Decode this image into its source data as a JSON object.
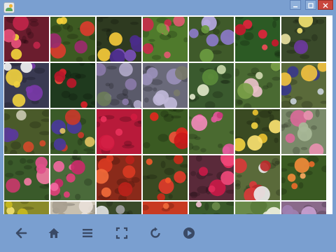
{
  "window": {
    "icon": "photo-viewer-app-icon",
    "controls": [
      "minimize-icon",
      "maximize-icon",
      "close-icon"
    ]
  },
  "grid": {
    "tiles": [
      {
        "bg": "#6b1d2e",
        "accents": [
          "#c0254a",
          "#f2d23c",
          "#e6507a"
        ]
      },
      {
        "bg": "#3d5a22",
        "accents": [
          "#d93c2e",
          "#f5d03a",
          "#9b2a6e"
        ]
      },
      {
        "bg": "#2e3a20",
        "accents": [
          "#4b2c8a",
          "#f4c93a",
          "#7a4fb8"
        ]
      },
      {
        "bg": "#4f7a2c",
        "accents": [
          "#c82d4a",
          "#e05a70",
          "#6c9a3a"
        ]
      },
      {
        "bg": "#3f5a2a",
        "accents": [
          "#8b7ac8",
          "#b5a8e0",
          "#6a9a40"
        ]
      },
      {
        "bg": "#2c5a24",
        "accents": [
          "#e0243c",
          "#c8182e",
          "#f04a58"
        ]
      },
      {
        "bg": "#3a4a2a",
        "accents": [
          "#f0e070",
          "#6a3a9a",
          "#e8e0a0"
        ]
      },
      {
        "bg": "#3a3a52",
        "accents": [
          "#7a3aa8",
          "#f0d040",
          "#f0f0f0"
        ]
      },
      {
        "bg": "#1f3a1e",
        "accents": [
          "#d8202a",
          "#b8182a",
          "#e84a3a"
        ]
      },
      {
        "bg": "#5a5a6a",
        "accents": [
          "#8a7aa8",
          "#b0a8c8",
          "#6a7a5a"
        ]
      },
      {
        "bg": "#6a6a7a",
        "accents": [
          "#9a90b8",
          "#c0b8d8",
          "#787a6a"
        ]
      },
      {
        "bg": "#3a5a2e",
        "accents": [
          "#e0e6c8",
          "#5a8a3a",
          "#c8d8a8"
        ]
      },
      {
        "bg": "#4a6a32",
        "accents": [
          "#e8c0c8",
          "#7aa048",
          "#d0d8b0"
        ]
      },
      {
        "bg": "#5a6a3a",
        "accents": [
          "#3a3a8a",
          "#f0c040",
          "#c8d0d8"
        ]
      },
      {
        "bg": "#4a5a2a",
        "accents": [
          "#5a3a9a",
          "#d04a2a",
          "#c8c8b0"
        ]
      },
      {
        "bg": "#3a5a28",
        "accents": [
          "#4a3a9a",
          "#c83a2a",
          "#e0c060"
        ]
      },
      {
        "bg": "#b81a3a",
        "accents": [
          "#e8305a",
          "#d01a40",
          "#f0607a"
        ]
      },
      {
        "bg": "#3a5a22",
        "accents": [
          "#e0281e",
          "#c81a1a",
          "#f0503a"
        ]
      },
      {
        "bg": "#4a6a30",
        "accents": [
          "#e05a9a",
          "#c83a7a",
          "#f08ab8"
        ]
      },
      {
        "bg": "#3a4a22",
        "accents": [
          "#f0d040",
          "#e8c030",
          "#f8e070"
        ]
      },
      {
        "bg": "#7a8a6a",
        "accents": [
          "#e890b0",
          "#d86a98",
          "#a8b898"
        ]
      },
      {
        "bg": "#3a5a2a",
        "accents": [
          "#e0508a",
          "#f078a0",
          "#c8386a"
        ]
      },
      {
        "bg": "#4a6a3a",
        "accents": [
          "#e0407a",
          "#f068a0",
          "#c82a68"
        ]
      },
      {
        "bg": "#8a2a1a",
        "accents": [
          "#d83a22",
          "#f06a3a",
          "#b8221a"
        ]
      },
      {
        "bg": "#3a4a22",
        "accents": [
          "#e03a2a",
          "#f0582a",
          "#c82a1a"
        ]
      },
      {
        "bg": "#5a2a3a",
        "accents": [
          "#e02a5a",
          "#f0487a",
          "#c81a48"
        ]
      },
      {
        "bg": "#5a6a3a",
        "accents": [
          "#d83a3a",
          "#e8e8e8",
          "#b82a2a"
        ]
      },
      {
        "bg": "#3a5a22",
        "accents": [
          "#f08a3a",
          "#e86a2a",
          "#f8a860"
        ]
      },
      {
        "bg": "#8a8a2a",
        "accents": [
          "#e0d040",
          "#c8b820",
          "#f0e070"
        ]
      },
      {
        "bg": "#c8c0b0",
        "accents": [
          "#d0d0c8",
          "#a8a090",
          "#e8e0d8"
        ]
      },
      {
        "bg": "#3a4a2a",
        "accents": [
          "#e0e0e0",
          "#a0a0a0",
          "#8a9a6a"
        ]
      },
      {
        "bg": "#c83a22",
        "accents": [
          "#f06a3a",
          "#e85a2a",
          "#d83a22"
        ]
      },
      {
        "bg": "#3a5a2a",
        "accents": [
          "#f0c0d0",
          "#6a8a4a",
          "#d8e0c8"
        ]
      },
      {
        "bg": "#6a8a4a",
        "accents": [
          "#e8e8d8",
          "#5a7a3a",
          "#f0f0e0"
        ]
      },
      {
        "bg": "#8a6a8a",
        "accents": [
          "#c8a0d0",
          "#a080b0",
          "#e0c8e8"
        ]
      }
    ]
  },
  "toolbar": {
    "buttons": [
      "back-arrow-icon",
      "home-icon",
      "menu-icon",
      "fullscreen-icon",
      "refresh-icon",
      "play-icon"
    ],
    "icon_color": "#3a4a66"
  }
}
